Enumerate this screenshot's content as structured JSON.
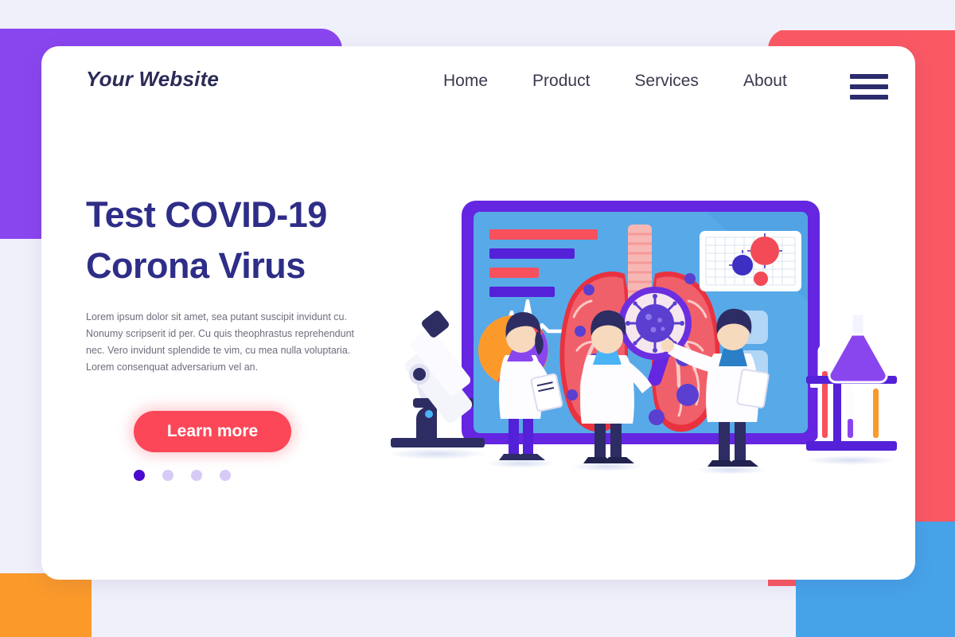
{
  "brand": {
    "logo": "Your Website"
  },
  "nav": {
    "items": [
      {
        "label": "Home"
      },
      {
        "label": "Product"
      },
      {
        "label": "Services"
      },
      {
        "label": "About"
      }
    ],
    "menu_icon": "hamburger-icon"
  },
  "hero": {
    "title_line1": "Test COVID-19",
    "title_line2": "Corona Virus",
    "paragraph": "Lorem ipsum dolor sit amet, sea putant suscipit invidunt cu. Nonumy scripserit id per. Cu quis theophrastus reprehendunt nec. Vero invidunt splendide te vim, cu mea nulla voluptaria. Lorem consenquat adversarium vel an.",
    "cta_label": "Learn more",
    "carousel": {
      "total": 4,
      "active_index": 0
    }
  },
  "illustration": {
    "name": "covid-lab-testing-illustration",
    "elements": [
      "monitor-screen",
      "lungs-diagram",
      "trachea",
      "ecg-line",
      "bar-chart-rows",
      "virus-grid-panel",
      "magnifier-virus",
      "doctor-female-tablet",
      "doctor-male-center",
      "doctor-male-clipboard",
      "microscope",
      "pie-chart",
      "test-tube-rack",
      "flask"
    ]
  },
  "colors": {
    "page_bg": "#f0f0fb",
    "card_bg": "#ffffff",
    "blob_purple": "#8a46ee",
    "blob_red": "#fa5964",
    "blob_orange": "#fb9a2b",
    "blob_blue": "#47a3e8",
    "heading": "#2e2d87",
    "body_text": "#6d6d7d",
    "cta": "#fb4758",
    "nav_text": "#3a3a4e",
    "dot_active": "#4a09cc",
    "dot_inactive": "#d6caf7",
    "screen_blue": "#58a9e8",
    "bezel_purple": "#6426e0",
    "lung_red": "#f0606a",
    "virus_purple": "#5b3fd0",
    "virus_red": "#f24a56"
  }
}
